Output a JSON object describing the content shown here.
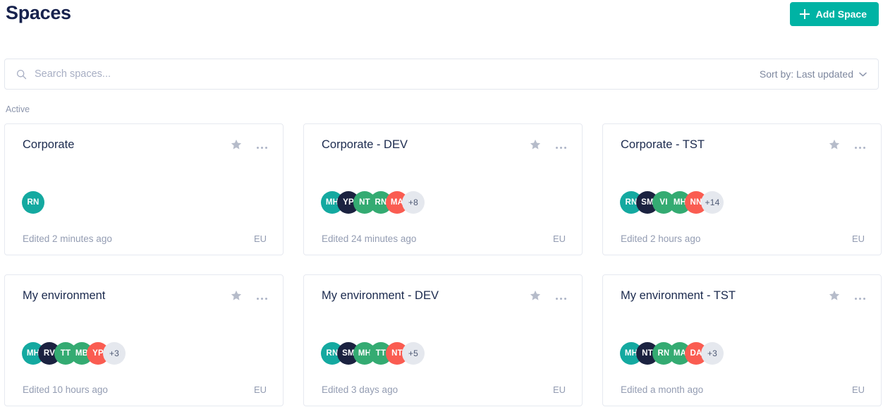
{
  "header": {
    "title": "Spaces",
    "add_space_label": "Add Space",
    "add_space_icon": "plus-icon",
    "accent_color": "#00b3a4"
  },
  "search": {
    "placeholder": "Search spaces...",
    "value": "",
    "icon": "search-icon",
    "sort_label": "Sort by: Last updated",
    "sort_icon": "chevron-down-icon"
  },
  "section": {
    "label": "Active"
  },
  "avatar_colors": {
    "teal": "#14a9a0",
    "navy": "#1b2240",
    "green": "#34ab72",
    "red": "#fa5c51",
    "more": "#e5e8ee"
  },
  "cards": [
    {
      "title": "Corporate",
      "edited": "Edited 2 minutes ago",
      "region": "EU",
      "star_icon": "star-icon",
      "menu_icon": "more-options-icon",
      "avatars": [
        {
          "initials": "RN",
          "color": "#14a9a0"
        }
      ],
      "overflow": ""
    },
    {
      "title": "Corporate - DEV",
      "edited": "Edited 24 minutes ago",
      "region": "EU",
      "star_icon": "star-icon",
      "menu_icon": "more-options-icon",
      "avatars": [
        {
          "initials": "MH",
          "color": "#14a9a0"
        },
        {
          "initials": "YP",
          "color": "#1b2240"
        },
        {
          "initials": "NT",
          "color": "#34ab72"
        },
        {
          "initials": "RN",
          "color": "#34ab72"
        },
        {
          "initials": "MA",
          "color": "#fa5c51"
        }
      ],
      "overflow": "+8"
    },
    {
      "title": "Corporate - TST",
      "edited": "Edited 2 hours ago",
      "region": "EU",
      "star_icon": "star-icon",
      "menu_icon": "more-options-icon",
      "avatars": [
        {
          "initials": "RN",
          "color": "#14a9a0"
        },
        {
          "initials": "SM",
          "color": "#1b2240"
        },
        {
          "initials": "VI",
          "color": "#34ab72"
        },
        {
          "initials": "MH",
          "color": "#34ab72"
        },
        {
          "initials": "NN",
          "color": "#fa5c51"
        }
      ],
      "overflow": "+14"
    },
    {
      "title": "My environment",
      "edited": "Edited 10 hours ago",
      "region": "EU",
      "star_icon": "star-icon",
      "menu_icon": "more-options-icon",
      "avatars": [
        {
          "initials": "MH",
          "color": "#14a9a0"
        },
        {
          "initials": "RV",
          "color": "#1b2240"
        },
        {
          "initials": "TT",
          "color": "#34ab72"
        },
        {
          "initials": "MB",
          "color": "#34ab72"
        },
        {
          "initials": "YP",
          "color": "#fa5c51"
        }
      ],
      "overflow": "+3"
    },
    {
      "title": "My environment - DEV",
      "edited": "Edited 3 days ago",
      "region": "EU",
      "star_icon": "star-icon",
      "menu_icon": "more-options-icon",
      "avatars": [
        {
          "initials": "RN",
          "color": "#14a9a0"
        },
        {
          "initials": "SM",
          "color": "#1b2240"
        },
        {
          "initials": "MH",
          "color": "#34ab72"
        },
        {
          "initials": "TT",
          "color": "#34ab72"
        },
        {
          "initials": "NT",
          "color": "#fa5c51"
        }
      ],
      "overflow": "+5"
    },
    {
      "title": "My environment - TST",
      "edited": "Edited a month ago",
      "region": "EU",
      "star_icon": "star-icon",
      "menu_icon": "more-options-icon",
      "avatars": [
        {
          "initials": "MH",
          "color": "#14a9a0"
        },
        {
          "initials": "NT",
          "color": "#1b2240"
        },
        {
          "initials": "RN",
          "color": "#34ab72"
        },
        {
          "initials": "MA",
          "color": "#34ab72"
        },
        {
          "initials": "DA",
          "color": "#fa5c51"
        }
      ],
      "overflow": "+3"
    }
  ]
}
